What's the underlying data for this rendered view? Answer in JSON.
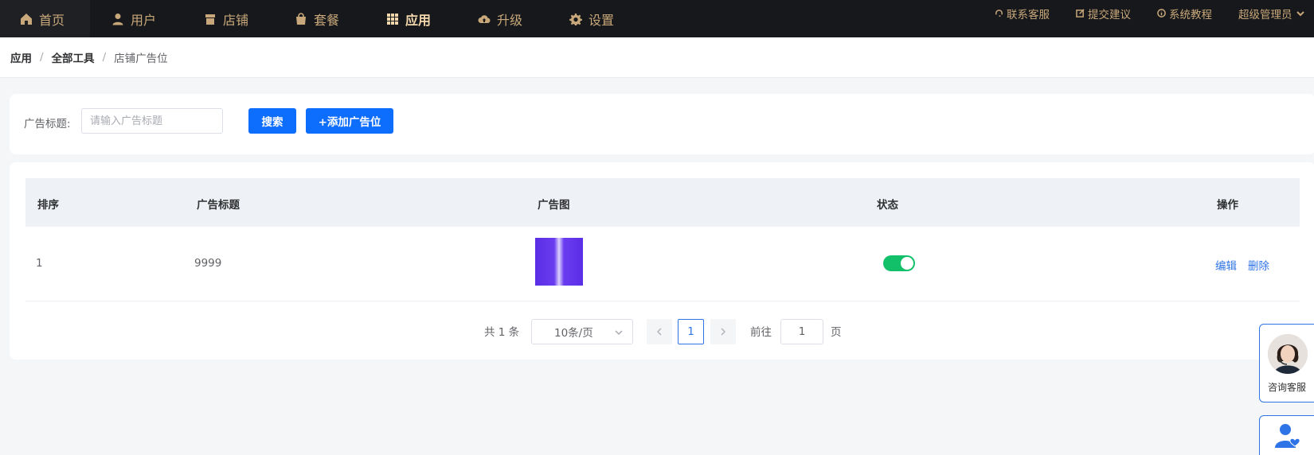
{
  "nav": {
    "items": [
      {
        "label": "首页",
        "icon": "home-icon"
      },
      {
        "label": "用户",
        "icon": "user-icon"
      },
      {
        "label": "店铺",
        "icon": "store-icon"
      },
      {
        "label": "套餐",
        "icon": "bag-icon"
      },
      {
        "label": "应用",
        "icon": "grid-icon",
        "active": true
      },
      {
        "label": "升级",
        "icon": "cloud-upload-icon"
      },
      {
        "label": "设置",
        "icon": "gear-icon"
      }
    ],
    "right": [
      {
        "label": "联系客服",
        "icon": "headset-icon"
      },
      {
        "label": "提交建议",
        "icon": "edit-icon"
      },
      {
        "label": "系统教程",
        "icon": "info-icon"
      }
    ],
    "user": "超级管理员",
    "accent": "#c8a87a",
    "background": "#17181b"
  },
  "breadcrumb": {
    "items": [
      "应用",
      "全部工具",
      "店铺广告位"
    ],
    "separator": "/"
  },
  "search": {
    "label": "广告标题:",
    "placeholder": "请输入广告标题",
    "value": "",
    "search_button": "搜索",
    "add_button": "+添加广告位"
  },
  "table": {
    "columns": [
      "排序",
      "广告标题",
      "广告图",
      "状态",
      "操作"
    ],
    "rows": [
      {
        "order": "1",
        "title": "9999",
        "image": "ad-thumbnail",
        "status_on": true,
        "edit": "编辑",
        "delete": "删除"
      }
    ]
  },
  "pagination": {
    "total_text": "共 1 条",
    "page_size": "10条/页",
    "current_page": "1",
    "goto_prefix": "前往",
    "goto_value": "1",
    "goto_suffix": "页"
  },
  "floating": {
    "service_label": "咨询客服"
  },
  "colors": {
    "primary": "#0d6efd",
    "link": "#2f74e6",
    "switch_on": "#13c06a"
  }
}
